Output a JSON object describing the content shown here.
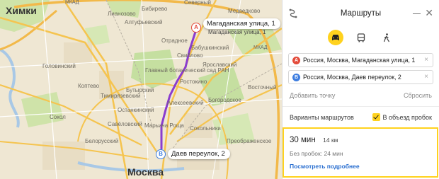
{
  "map": {
    "labels": {
      "khimki": "Химки",
      "moscow": "Москва",
      "mkad": "МКАД",
      "mkad2": "МКАД",
      "bibirevo": "Бибирево",
      "altufyevsky": "Алтуфьевский",
      "lianozovo": "Лианозово",
      "sviblovo": "Свиблово",
      "babushkinsky": "Бабушкинский",
      "yaroslavsky": "Ярославский",
      "rostokino": "Ростокино",
      "ostankinsky": "Останкинский",
      "alekseevsky": "Алексеевский",
      "marina_roshcha": "Марьина Роща",
      "bogorodskoe": "Богородское",
      "sokolniki": "Сокольники",
      "belorussky": "Белорусский",
      "koptevo": "Коптево",
      "timiryazevsky": "Тимирязевский",
      "butyrsky": "Бутырский",
      "otradnoe": "Отрадное",
      "garden": "Главный ботанический сад РАН",
      "north": "Северный",
      "medvedkovo": "Медведково",
      "golovinsky": "Головинский",
      "savelovsky": "Савёловский",
      "preobrazhenskoe": "Преображенское",
      "sokol": "Сокол",
      "vostochny": "Восточный"
    },
    "pin_a": {
      "letter": "A",
      "label": "Магаданская улица, 1",
      "sub": "Магаданская улица, 1"
    },
    "pin_b": {
      "letter": "B",
      "label": "Даев переулок, 2"
    }
  },
  "panel": {
    "title": "Маршруты",
    "modes": [
      "car-icon",
      "bus-icon",
      "walk-icon"
    ],
    "from": {
      "letter": "A",
      "value": "Россия, Москва, Магаданская улица, 1"
    },
    "to": {
      "letter": "B",
      "value": "Россия, Москва, Даев переулок, 2"
    },
    "add_point": "Добавить точку",
    "reset": "Сбросить",
    "variants_label": "Варианты маршрутов",
    "avoid_traffic": "В объезд пробок",
    "result": {
      "time": "30 мин",
      "distance": "14 км",
      "no_traffic": "Без пробок: 24 мин",
      "more": "Посмотреть подробнее"
    }
  },
  "colors": {
    "accent": "#ffd21e",
    "route": "#8a3ccf",
    "pin_a": "#e34b3b",
    "pin_b": "#3d7de0"
  }
}
